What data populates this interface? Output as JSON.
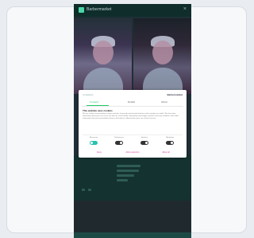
{
  "app": {
    "brand": "Barbermarket",
    "close_glyph": "×"
  },
  "dialog": {
    "logo_text": "Cookiebot",
    "brand_text": "Barbermarket",
    "tabs": [
      {
        "label": "Consent",
        "active": true
      },
      {
        "label": "Details",
        "active": false
      },
      {
        "label": "About",
        "active": false
      }
    ],
    "heading": "This website uses cookies",
    "body": "We use cookies to personalise content and ads, to provide social media features and to analyse our traffic. We also share information about your use of our site with our social media, advertising and analytics partners who may combine it with other information that you've provided to them or that they've collected from your use of their services.",
    "toggles": [
      {
        "label": "Necessary",
        "on": true
      },
      {
        "label": "Preferences",
        "on": false
      },
      {
        "label": "Statistics",
        "on": false
      },
      {
        "label": "Marketing",
        "on": false
      }
    ],
    "buttons": {
      "deny": "Deny",
      "allow_selection": "Allow selection",
      "allow_all": "Allow all"
    }
  },
  "colors": {
    "accent_green": "#27c2b0",
    "button_pink": "#d43fa0",
    "header_bg": "#0f2d2b"
  }
}
